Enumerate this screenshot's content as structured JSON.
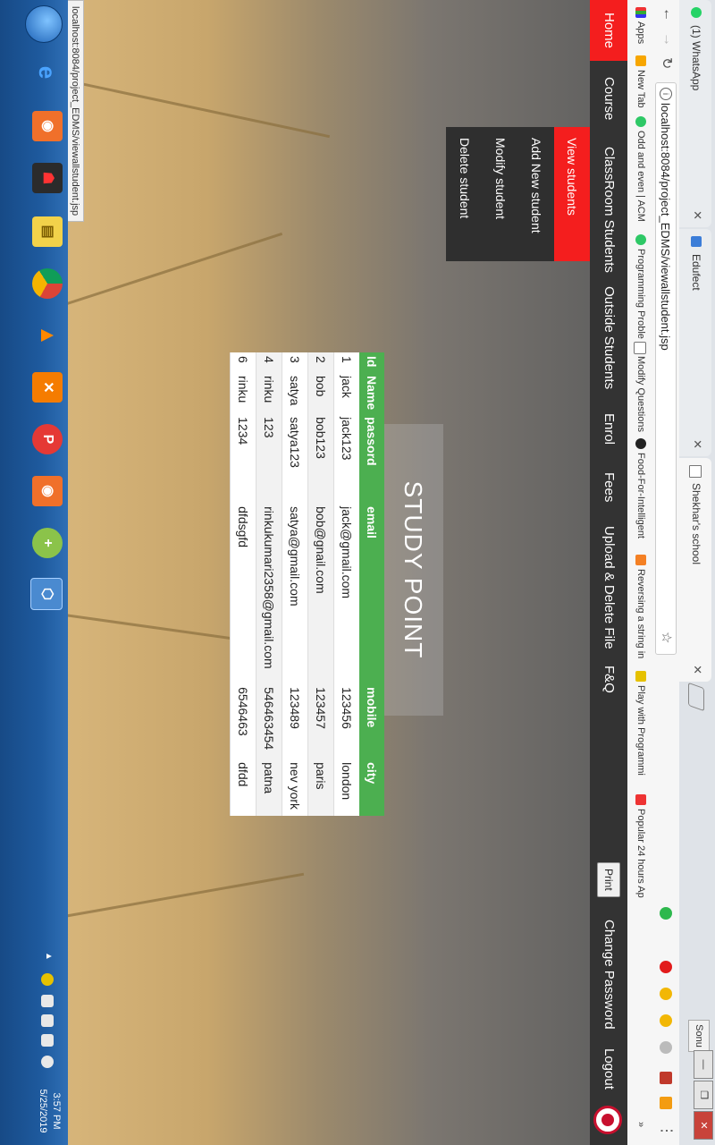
{
  "browser": {
    "tabs": [
      {
        "title": "(1) WhatsApp",
        "active": false
      },
      {
        "title": "Edufect",
        "active": false
      },
      {
        "title": "Shekhar's school",
        "active": true
      }
    ],
    "profile_label": "Sonu",
    "url": "localhost:8084/project_EDMS/viewallstudent.jsp",
    "bookmarks": [
      "Apps",
      "New Tab",
      "Odd and even | ACM",
      "Programming Proble",
      "Modify Questions",
      "Food-For-Intelligent",
      "Reversing a string in",
      "Play with Programmi",
      "Popular 24 hours Ap"
    ]
  },
  "nav": {
    "items": [
      "Home",
      "Course",
      "ClassRoom Students",
      "Outside Students",
      "Enrol",
      "Fees",
      "Upload & Delete File",
      "F&Q"
    ],
    "print_label": "Print",
    "change_password": "Change Password",
    "logout": "Logout"
  },
  "dropdown": {
    "items": [
      "View students",
      "Add New student",
      "Modify student",
      "Delete student"
    ]
  },
  "hero": {
    "title": "STUDY POINT"
  },
  "table": {
    "headers": [
      "Id",
      "Name",
      "passord",
      "email",
      "mobile",
      "city"
    ],
    "rows": [
      [
        "1",
        "jack",
        "jack123",
        "jack@gmail.com",
        "123456",
        "london"
      ],
      [
        "2",
        "bob",
        "bob123",
        "bob@gnail.com",
        "123457",
        "paris"
      ],
      [
        "3",
        "satya",
        "satya123",
        "satya@gmail.com",
        "123489",
        "nev york"
      ],
      [
        "4",
        "rinku",
        "123",
        "rinkukumari2358@gmail.com",
        "546463454",
        "patna"
      ],
      [
        "6",
        "rinku",
        "1234",
        "dfdsgfd",
        "6546463",
        "dfdd"
      ]
    ]
  },
  "status_url": "localhost:8084/project_EDMS/viewallstudent.jsp",
  "taskbar": {
    "time": "3:57 PM",
    "date": "5/25/2019"
  }
}
